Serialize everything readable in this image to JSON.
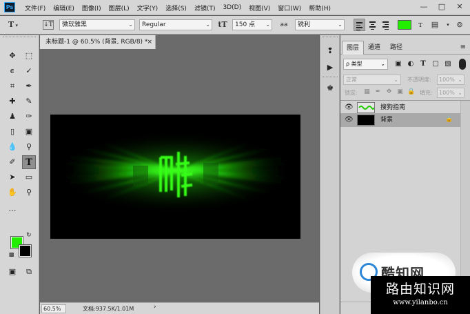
{
  "menubar": {
    "logo": "Ps",
    "items": [
      "文件(F)",
      "编辑(E)",
      "图像(I)",
      "图层(L)",
      "文字(Y)",
      "选择(S)",
      "滤镜(T)",
      "3D(D)",
      "视图(V)",
      "窗口(W)",
      "帮助(H)"
    ],
    "window_controls": [
      "minimize-icon",
      "maximize-icon",
      "close-icon"
    ]
  },
  "options": {
    "tool_icon": "T",
    "font_family": "微软雅黑",
    "font_style": "Regular",
    "size_icon": "tT",
    "font_size": "150 点",
    "aa_icon": "aa",
    "antialias": "锐利",
    "text_color": "#22ee00"
  },
  "document": {
    "tab_title": "未标题-1 @ 60.5% (背景, RGB/8) *",
    "tab_close": "×",
    "zoom": "60.5%",
    "doc_size": "文档:937.5K/1.01M",
    "canvas_bg": "#000000",
    "effect_color": "#22ee00"
  },
  "tools": {
    "foreground_color": "#22ee00",
    "background_color": "#000000"
  },
  "layers_panel": {
    "tabs": [
      "图层",
      "通道",
      "路径"
    ],
    "kind_filter": "ρ 类型",
    "blend_mode": "正常",
    "opacity_label": "不透明度:",
    "opacity_value": "100%",
    "lock_label": "锁定:",
    "fill_label": "填充:",
    "fill_value": "100%",
    "layers": [
      {
        "name": "搜狗指南",
        "visible": true,
        "selected": false
      },
      {
        "name": "背景",
        "visible": true,
        "selected": true,
        "locked": true
      }
    ]
  },
  "watermark": {
    "logo_text": "酷知网",
    "title": "路由知识网",
    "url": "www.yilanbo.cn"
  }
}
